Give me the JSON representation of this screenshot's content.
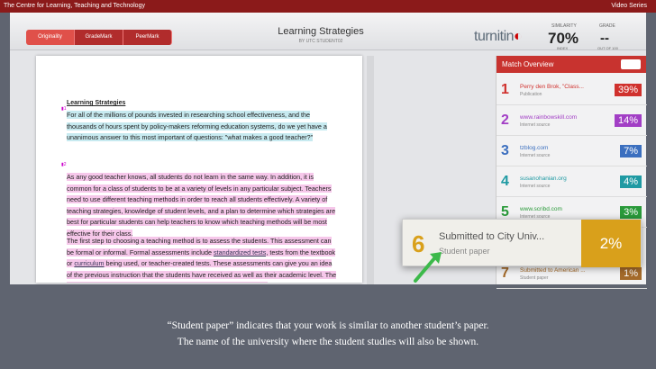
{
  "header_bar": {
    "left": "The Centre for Learning, Teaching and Technology",
    "right": "Video Series"
  },
  "modes": [
    "Originality",
    "GradeMark",
    "PeerMark"
  ],
  "document": {
    "title": "Learning Strategies",
    "subtitle": "BY UTC STUDENT02"
  },
  "brand": {
    "name": "turnitin",
    "accent": "#c8332f"
  },
  "similarity": {
    "label": "SIMILARITY",
    "value": "70%",
    "sub": "INDEX"
  },
  "grade": {
    "label": "GRADE",
    "value": "--",
    "sub": "OUT OF 100"
  },
  "paper": {
    "heading": "Learning Strategies",
    "p1": "For all of the millions of pounds invested in researching school effectiveness, and the thousands of hours spent by policy-makers reforming education systems, do we yet have a unanimous answer to this most important of questions: \"what makes a good teacher?\"",
    "p2": "As any good teacher knows, all students do not learn in the same way. In addition, it is common for a class of students to be at a variety of levels in any particular subject. Teachers need to use different teaching methods in order to reach all students effectively. A variety of teaching strategies, knowledge of student levels, and a plan to determine which strategies are best for particular students can help teachers to know which teaching methods will be most effective for their class.",
    "p3a": "The first step to choosing a teaching method is to assess the students. This assessment can be formal or informal. Formal assessments include ",
    "p3_link1": "standardized tests",
    "p3b": ", tests from the textbook or ",
    "p3_link2": "curriculum",
    "p3c": " being used, or teacher-created tests. These assessments can give you an idea of the previous instruction that the students have received as well as their academic level. The students in your class may have undergone various teaching methods"
  },
  "match_overview": {
    "title": "Match Overview",
    "rows": [
      {
        "n": "1",
        "title": "Perry den Brok, \"Class...",
        "source": "Publication",
        "pct": "39%",
        "color": "#d0312d"
      },
      {
        "n": "2",
        "title": "www.rainbowskill.com",
        "source": "Internet source",
        "pct": "14%",
        "color": "#a23ec5"
      },
      {
        "n": "3",
        "title": "tzblog.com",
        "source": "Internet source",
        "pct": "7%",
        "color": "#3b6fbf"
      },
      {
        "n": "4",
        "title": "susanohanian.org",
        "source": "Internet source",
        "pct": "4%",
        "color": "#1f9aa3"
      },
      {
        "n": "5",
        "title": "www.scribd.com",
        "source": "Internet source",
        "pct": "3%",
        "color": "#2a9a3a"
      },
      {
        "n": "7",
        "title": "Submitted to American ...",
        "source": "Student paper",
        "pct": "1%",
        "color": "#a46a2a"
      }
    ]
  },
  "popup": {
    "n": "6",
    "title": "Submitted to City Univ...",
    "source": "Student paper",
    "pct": "2%",
    "color": "#d9a01b"
  },
  "caption": {
    "line1": "“Student paper” indicates that your work is similar to another student’s paper.",
    "line2": "The name of the university where the student studies will also be shown."
  }
}
